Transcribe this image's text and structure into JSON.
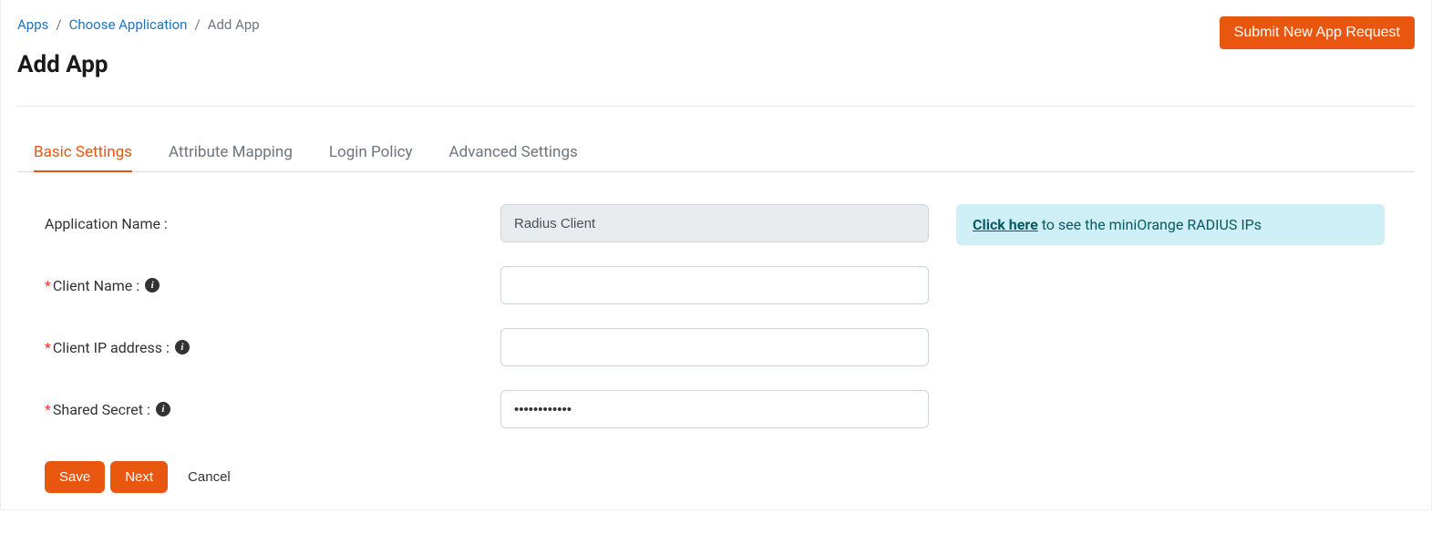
{
  "breadcrumb": {
    "apps": "Apps",
    "choose": "Choose Application",
    "current": "Add App"
  },
  "header": {
    "submit_btn": "Submit New App Request",
    "title": "Add App"
  },
  "tabs": {
    "basic": "Basic Settings",
    "attribute": "Attribute Mapping",
    "login": "Login Policy",
    "advanced": "Advanced Settings"
  },
  "form": {
    "application_name": {
      "label": "Application Name :",
      "value": "Radius Client"
    },
    "client_name": {
      "label": "Client Name :",
      "value": ""
    },
    "client_ip": {
      "label": "Client IP address :",
      "value": ""
    },
    "shared_secret": {
      "label": "Shared Secret :",
      "value": "••••••••••••"
    }
  },
  "info": {
    "link": "Click here",
    "text": " to see the miniOrange RADIUS IPs"
  },
  "buttons": {
    "save": "Save",
    "next": "Next",
    "cancel": "Cancel"
  }
}
